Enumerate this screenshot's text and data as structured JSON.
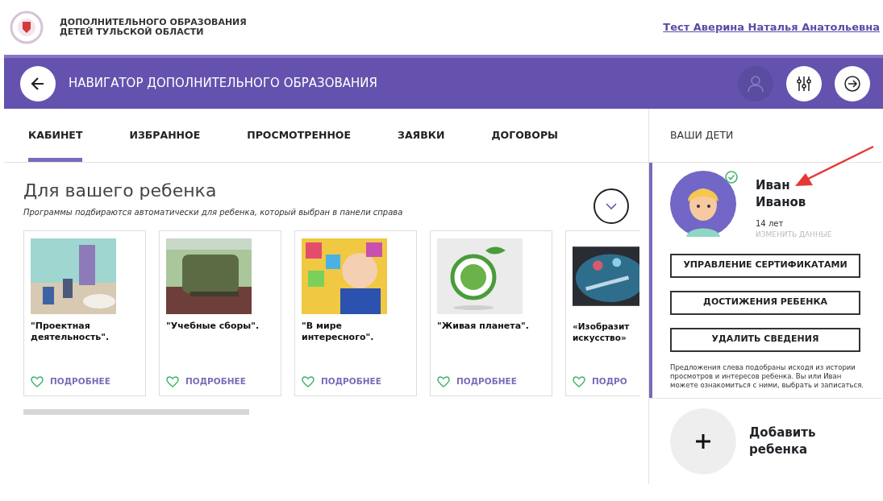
{
  "header": {
    "org_lines": [
      "ДОПОЛНИТЕЛЬНОГО ОБРАЗОВАНИЯ",
      "ДЕТЕЙ ТУЛЬСКОЙ ОБЛАСТИ"
    ],
    "user": "Тест Аверина Наталья Анатольевна"
  },
  "navbar": {
    "title": "НАВИГАТОР ДОПОЛНИТЕЛЬНОГО ОБРАЗОВАНИЯ"
  },
  "tabs": [
    {
      "label": "КАБИНЕТ",
      "selected": true
    },
    {
      "label": "ИЗБРАННОЕ",
      "selected": false
    },
    {
      "label": "ПРОСМОТРЕННОЕ",
      "selected": false
    },
    {
      "label": "ЗАЯВКИ",
      "selected": false
    },
    {
      "label": "ДОГОВОРЫ",
      "selected": false
    }
  ],
  "recommend": {
    "title": "Для вашего ребенка",
    "subtitle": "Программы подбираются автоматически для ребенка, который выбран в панели справа",
    "cards": [
      {
        "title": "\"Проектная деятельность\".",
        "link": "ПОДРОБНЕЕ"
      },
      {
        "title": "\"Учебные сборы\".",
        "link": "ПОДРОБНЕЕ"
      },
      {
        "title": "\"В мире интересного\".",
        "link": "ПОДРОБНЕЕ"
      },
      {
        "title": "\"Живая планета\".",
        "link": "ПОДРОБНЕЕ"
      },
      {
        "title": "«Изобразит искусство»",
        "link": "ПОДРО"
      }
    ]
  },
  "children_panel": {
    "title": "ВАШИ ДЕТИ",
    "child": {
      "first_name": "Иван",
      "last_name": "Иванов",
      "age": "14 лет",
      "edit": "ИЗМЕНИТЬ ДАННЫЕ",
      "verified": true
    },
    "buttons": [
      "УПРАВЛЕНИЕ СЕРТИФИКАТАМИ",
      "ДОСТИЖЕНИЯ РЕБЕНКА",
      "УДАЛИТЬ СВЕДЕНИЯ"
    ],
    "note": "Предложения слева подобраны исходя из истории просмотров и интересов ребенка. Вы или Иван можете ознакомиться с ними, выбрать и записаться.",
    "add": "Добавить ребенка"
  }
}
